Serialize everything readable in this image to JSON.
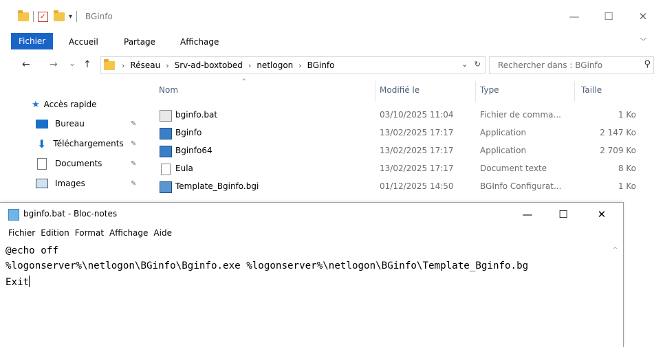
{
  "explorer": {
    "title": "BGinfo",
    "window_buttons": {
      "minimize": "—",
      "maximize": "☐",
      "close": "✕"
    },
    "ribbon": {
      "tabs": [
        {
          "label": "Fichier",
          "active": true
        },
        {
          "label": "Accueil"
        },
        {
          "label": "Partage"
        },
        {
          "label": "Affichage"
        }
      ],
      "expand": "﹀"
    },
    "nav_buttons": {
      "back": "←",
      "forward": "→",
      "recent": "⌄",
      "up": "↑"
    },
    "address": {
      "segments": [
        "Réseau",
        "Srv-ad-boxtobed",
        "netlogon",
        "BGinfo"
      ],
      "sep": "›",
      "dropdown": "⌄",
      "refresh": "↻"
    },
    "search": {
      "placeholder": "Rechercher dans : BGinfo",
      "icon": "⚲"
    },
    "quick_access": {
      "header": "Accès rapide",
      "items": [
        {
          "label": "Bureau",
          "pin": "📌"
        },
        {
          "label": "Téléchargements",
          "pin": "📌"
        },
        {
          "label": "Documents",
          "pin": "📌"
        },
        {
          "label": "Images",
          "pin": "📌"
        }
      ]
    },
    "columns": {
      "name": "Nom",
      "modified": "Modifié le",
      "type": "Type",
      "size": "Taille",
      "sort_arrow": "^"
    },
    "files": [
      {
        "name": "bginfo.bat",
        "modified": "03/10/2025 11:04",
        "type": "Fichier de comma...",
        "size": "1 Ko",
        "icon": "batch-file"
      },
      {
        "name": "Bginfo",
        "modified": "13/02/2025 17:17",
        "type": "Application",
        "size": "2 147 Ko",
        "icon": "application"
      },
      {
        "name": "Bginfo64",
        "modified": "13/02/2025 17:17",
        "type": "Application",
        "size": "2 709 Ko",
        "icon": "application"
      },
      {
        "name": "Eula",
        "modified": "13/02/2025 17:17",
        "type": "Document texte",
        "size": "8 Ko",
        "icon": "text-document"
      },
      {
        "name": "Template_Bginfo.bgi",
        "modified": "01/12/2025 14:50",
        "type": "BGInfo Configurat...",
        "size": "1 Ko",
        "icon": "bginfo-config"
      }
    ]
  },
  "notepad": {
    "title": "bginfo.bat - Bloc-notes",
    "window_buttons": {
      "minimize": "—",
      "maximize": "☐",
      "close": "✕"
    },
    "menu": [
      "Fichier",
      "Edition",
      "Format",
      "Affichage",
      "Aide"
    ],
    "lines": [
      "@echo off",
      "%logonserver%\\netlogon\\BGinfo\\Bginfo.exe %logonserver%\\netlogon\\BGinfo\\Template_Bginfo.bg",
      "Exit"
    ],
    "scroll_up": "^"
  },
  "colors": {
    "accent": "#1a64c7",
    "folder": "#f4c54b",
    "header_text": "#4c607a"
  }
}
